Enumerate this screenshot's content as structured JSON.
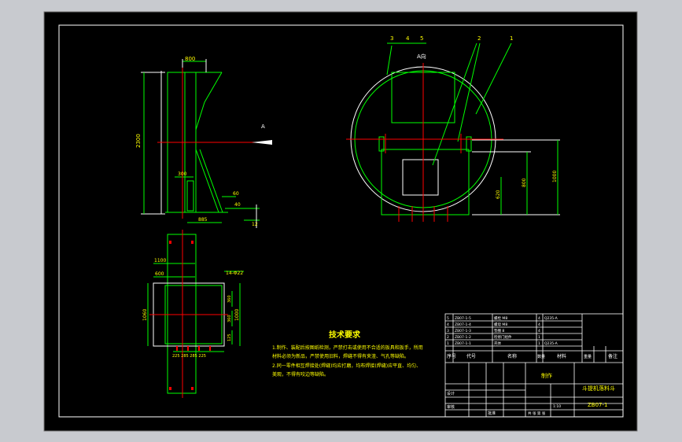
{
  "drawing": {
    "colors": {
      "background": "#000000",
      "surround": "#c8cacf",
      "line": "#ffffff",
      "geometry": "#00ff00",
      "centerline": "#ff0000",
      "annotation": "#ffff00",
      "table": "#ffffff"
    },
    "front_view": {
      "dim_width": "800",
      "dim_height": "2300",
      "dim_inner": "300",
      "dim_bottom": "885",
      "dim_small_a": "60",
      "dim_small_b": "40",
      "dim_small_c": "12",
      "arrow_label": "A"
    },
    "top_view": {
      "dim_1100": "1100",
      "dim_600": "600",
      "dim_14": "14-Φ22",
      "dim_left": "1060",
      "dim_right": "1000",
      "dim_inner_a": "360",
      "dim_inner_b": "360",
      "dim_inner_c": "125",
      "dim_bottom": "225 285 285 225"
    },
    "side_view": {
      "balloons": [
        "3",
        "4",
        "5",
        "2",
        "1"
      ],
      "view_label": "A向",
      "dim_a": "620",
      "dim_b": "800",
      "dim_c": "1000"
    },
    "tech_notes": {
      "title": "技术要求",
      "line1": "1.制作、装配后按图纸检测，严禁打击或使用不合适的扳具和扳手，所用",
      "line2": "  材料必须为新品，严禁使用旧料，焊缝不得有夹渣、气孔等缺陷。",
      "line3": "2.同一零件相互焊接处(焊缝)均应打磨，均布焊接(焊缝)应平直、均匀、",
      "line4": "  美观，不得有咬边等缺陷。"
    },
    "title_block": {
      "parts_rows": [
        [
          "5",
          "ZB07-1-5",
          "螺栓 M8",
          "4",
          "Q235-A",
          ""
        ],
        [
          "4",
          "ZB07-1-4",
          "螺母 M8",
          "4",
          "",
          ""
        ],
        [
          "3",
          "ZB07-1-3",
          "垫圈 8",
          "4",
          "",
          ""
        ],
        [
          "2",
          "ZB07-1-2",
          "检修门组件",
          "1",
          "",
          ""
        ],
        [
          "1",
          "ZB07-1-1",
          "壳体",
          "1",
          "Q235-A",
          ""
        ]
      ],
      "header_seq": "序号",
      "header_code": "代号",
      "header_name": "名称",
      "header_qty": "数量",
      "header_material": "材料",
      "header_weight": "重量",
      "header_remark": "备注",
      "company": "制作",
      "drawing_title": "斗提机落料斗",
      "drawing_no": "ZB07-1",
      "scale": "1:10",
      "sheet": "共 张 第 张",
      "designer": "设计",
      "checker": "审核",
      "approver": "批准"
    }
  }
}
